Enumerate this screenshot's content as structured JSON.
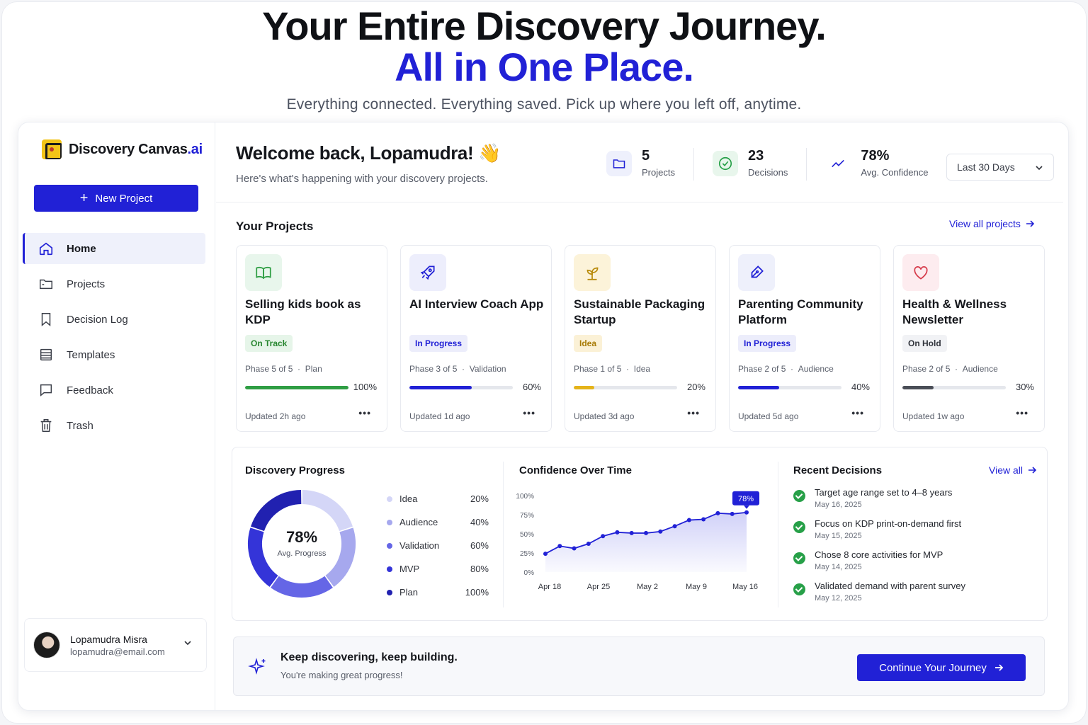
{
  "hero": {
    "line1": "Your Entire Discovery Journey.",
    "line2": "All in One Place.",
    "subtitle": "Everything connected. Everything saved. Pick up where you left off, anytime."
  },
  "brand": {
    "name": "Discovery Canvas",
    "suffix": ".ai"
  },
  "sidebar": {
    "new_project": "New Project",
    "items": [
      {
        "label": "Home",
        "icon": "home-icon",
        "active": true
      },
      {
        "label": "Projects",
        "icon": "folder-icon"
      },
      {
        "label": "Decision Log",
        "icon": "bookmark-icon"
      },
      {
        "label": "Templates",
        "icon": "templates-icon"
      },
      {
        "label": "Feedback",
        "icon": "chat-icon"
      },
      {
        "label": "Trash",
        "icon": "trash-icon"
      }
    ],
    "user": {
      "name": "Lopamudra Misra",
      "email": "lopamudra@email.com"
    }
  },
  "header": {
    "welcome": "Welcome back, Lopamudra! 👋",
    "subtitle": "Here's what's happening with your discovery projects.",
    "stats": [
      {
        "value": "5",
        "label": "Projects",
        "icon": "folder-icon",
        "color": "#2121d6"
      },
      {
        "value": "23",
        "label": "Decisions",
        "icon": "check-circle-icon",
        "color": "#27a048"
      },
      {
        "value": "78%",
        "label": "Avg. Confidence",
        "icon": "trend-icon",
        "color": "#2121d6"
      }
    ],
    "range": "Last 30 Days"
  },
  "projects": {
    "title": "Your Projects",
    "view_all": "View all projects",
    "items": [
      {
        "title": "Selling kids book as KDP",
        "badge": "On Track",
        "phase": "Phase 5 of 5",
        "stage": "Plan",
        "progress": 100,
        "pct": "100%",
        "updated": "Updated 2h ago",
        "icon": "book-icon",
        "accent": "#2f9e44",
        "bg": "#e8f6ec",
        "badge_color": "#27862f",
        "badge_bg": "#e6f5e9"
      },
      {
        "title": "AI Interview Coach App",
        "badge": "In Progress",
        "phase": "Phase 3 of 5",
        "stage": "Validation",
        "progress": 60,
        "pct": "60%",
        "updated": "Updated 1d ago",
        "icon": "rocket-icon",
        "accent": "#2121d6",
        "bg": "#edeefc",
        "badge_color": "#2121d6",
        "badge_bg": "#ecedfb"
      },
      {
        "title": "Sustainable Packaging Startup",
        "badge": "Idea",
        "phase": "Phase 1 of 5",
        "stage": "Idea",
        "progress": 20,
        "pct": "20%",
        "updated": "Updated 3d ago",
        "icon": "sprout-icon",
        "accent": "#e5b319",
        "bg": "#fcf3d9",
        "badge_color": "#a87b06",
        "badge_bg": "#fbf1d6"
      },
      {
        "title": "Parenting Community Platform",
        "badge": "In Progress",
        "phase": "Phase 2 of 5",
        "stage": "Audience",
        "progress": 40,
        "pct": "40%",
        "updated": "Updated 5d ago",
        "icon": "pen-icon",
        "accent": "#2121d6",
        "bg": "#eef0fb",
        "badge_color": "#2121d6",
        "badge_bg": "#ecedfb"
      },
      {
        "title": "Health & Wellness Newsletter",
        "badge": "On Hold",
        "phase": "Phase 2 of 5",
        "stage": "Audience",
        "progress": 30,
        "pct": "30%",
        "updated": "Updated 1w ago",
        "icon": "heart-icon",
        "accent": "#4a4e57",
        "bg": "#fdecef",
        "badge_color": "#30333b",
        "badge_bg": "#f1f2f5"
      }
    ],
    "more": "•••"
  },
  "progress": {
    "title": "Discovery Progress",
    "center_value": "78%",
    "center_label": "Avg. Progress",
    "legend": [
      {
        "label": "Idea",
        "value": "20%",
        "color": "#d4d6f7"
      },
      {
        "label": "Audience",
        "value": "40%",
        "color": "#a6a8ee"
      },
      {
        "label": "Validation",
        "value": "60%",
        "color": "#6566e6"
      },
      {
        "label": "MVP",
        "value": "80%",
        "color": "#3434d8"
      },
      {
        "label": "Plan",
        "value": "100%",
        "color": "#2121b0"
      }
    ]
  },
  "confidence": {
    "title": "Confidence Over Time",
    "tag": "78%"
  },
  "recent": {
    "title": "Recent Decisions",
    "view_all": "View all",
    "items": [
      {
        "text": "Target age range set to 4–8 years",
        "date": "May 16, 2025"
      },
      {
        "text": "Focus on KDP print-on-demand first",
        "date": "May 15, 2025"
      },
      {
        "text": "Chose 8 core activities for MVP",
        "date": "May 14, 2025"
      },
      {
        "text": "Validated demand with parent survey",
        "date": "May 12, 2025"
      }
    ]
  },
  "cta": {
    "title": "Keep discovering, keep building.",
    "subtitle": "You're making great progress!",
    "button": "Continue Your Journey"
  },
  "chart_data": {
    "type": "area",
    "title": "Confidence Over Time",
    "x_ticks": [
      "Apr 18",
      "Apr 25",
      "May 2",
      "May 9",
      "May 16"
    ],
    "y_ticks": [
      "0%",
      "25%",
      "50%",
      "75%",
      "100%"
    ],
    "ylim": [
      0,
      100
    ],
    "x": [
      "Apr 18",
      "Apr 21",
      "Apr 24",
      "Apr 27",
      "Apr 30",
      "May 2",
      "May 3",
      "May 4",
      "May 5",
      "May 8",
      "May 10",
      "May 13",
      "May 15",
      "May 16"
    ],
    "values": [
      24,
      34,
      31,
      37,
      47,
      52,
      51,
      51,
      53,
      60,
      68,
      69,
      77,
      76,
      78
    ],
    "highlight": "78%",
    "grid": false
  },
  "donut_data": {
    "type": "pie",
    "slices": [
      {
        "label": "Idea",
        "value": 20,
        "color": "#d4d6f7"
      },
      {
        "label": "Audience",
        "value": 20,
        "color": "#a6a8ee"
      },
      {
        "label": "Validation",
        "value": 20,
        "color": "#6566e6"
      },
      {
        "label": "MVP",
        "value": 20,
        "color": "#3434d8"
      },
      {
        "label": "Plan",
        "value": 20,
        "color": "#2121b0"
      }
    ]
  }
}
